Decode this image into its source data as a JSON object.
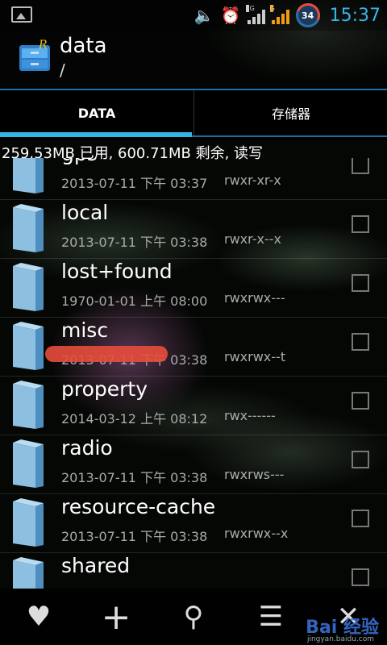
{
  "status": {
    "time": "15:37",
    "battery": "34",
    "net1": "3G",
    "net2": "G"
  },
  "header": {
    "title": "data",
    "path": "/"
  },
  "tabs": [
    {
      "label": "DATA"
    },
    {
      "label": "存储器"
    }
  ],
  "storage_info": "259.53MB 已用, 600.71MB 剩余, 读写",
  "files": [
    {
      "name": "gps",
      "date": "2013-07-11 下午 03:37",
      "perm": "rwxr-xr-x"
    },
    {
      "name": "local",
      "date": "2013-07-11 下午 03:38",
      "perm": "rwxr-x--x"
    },
    {
      "name": "lost+found",
      "date": "1970-01-01 上午 08:00",
      "perm": "rwxrwx---"
    },
    {
      "name": "misc",
      "date": "2013-07-11 下午 03:38",
      "perm": "rwxrwx--t"
    },
    {
      "name": "property",
      "date": "2014-03-12 上午 08:12",
      "perm": "rwx------"
    },
    {
      "name": "radio",
      "date": "2013-07-11 下午 03:38",
      "perm": "rwxrws---"
    },
    {
      "name": "resource-cache",
      "date": "2013-07-11 下午 03:38",
      "perm": "rwxrwx--x"
    },
    {
      "name": "shared",
      "date": "",
      "perm": ""
    }
  ],
  "bottom_actions": [
    {
      "icon": "heart-icon",
      "glyph": "♥"
    },
    {
      "icon": "plus-icon",
      "glyph": "+"
    },
    {
      "icon": "search-icon",
      "glyph": "⚲"
    },
    {
      "icon": "sort-icon",
      "glyph": "☰"
    },
    {
      "icon": "close-icon",
      "glyph": "✕"
    }
  ],
  "watermark": {
    "text": "Bai 经验",
    "sub": "jingyan.baidu.com"
  },
  "colors": {
    "accent": "#33b5e5",
    "clock": "#35b5e8",
    "highlight": "#e74c3c"
  }
}
